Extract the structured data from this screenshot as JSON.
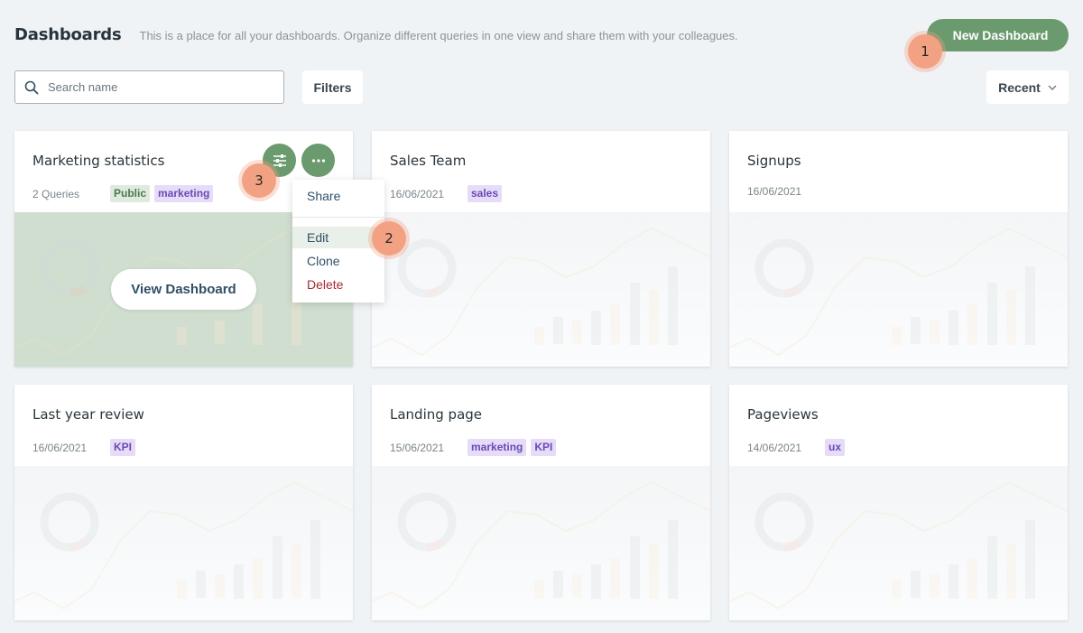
{
  "header": {
    "title": "Dashboards",
    "description": "This is a place for all your dashboards. Organize different queries in one view and share them with your colleagues.",
    "new_button": "New Dashboard"
  },
  "toolbar": {
    "search_placeholder": "Search name",
    "search_value": "",
    "filters_label": "Filters",
    "sort_label": "Recent"
  },
  "colors": {
    "accent": "#6a9a6e",
    "tag_purple_bg": "#e6dcf7",
    "tag_purple_text": "#6b49b8",
    "tag_green_bg": "#dfeadf",
    "tag_green_text": "#4b7a4e",
    "danger": "#a82a35",
    "step_badge": "#f3a183"
  },
  "cards": [
    {
      "title": "Marketing statistics",
      "meta": "2 Queries",
      "tags": [
        {
          "label": "Public",
          "style": "green"
        },
        {
          "label": "marketing",
          "style": "purple"
        }
      ],
      "hovered": true,
      "view_button": "View Dashboard"
    },
    {
      "title": "Sales Team",
      "meta": "16/06/2021",
      "tags": [
        {
          "label": "sales",
          "style": "purple"
        }
      ]
    },
    {
      "title": "Signups",
      "meta": "16/06/2021",
      "tags": []
    },
    {
      "title": "Last year review",
      "meta": "16/06/2021",
      "tags": [
        {
          "label": "KPI",
          "style": "purple"
        }
      ]
    },
    {
      "title": "Landing page",
      "meta": "15/06/2021",
      "tags": [
        {
          "label": "marketing",
          "style": "purple"
        },
        {
          "label": "KPI",
          "style": "purple"
        }
      ]
    },
    {
      "title": "Pageviews",
      "meta": "14/06/2021",
      "tags": [
        {
          "label": "ux",
          "style": "purple"
        }
      ]
    }
  ],
  "card_actions": {
    "settings_icon": "sliders-icon",
    "more_icon": "more-horizontal-icon"
  },
  "context_menu": {
    "items": [
      {
        "label": "Share"
      },
      {
        "label": "Edit",
        "active": true
      },
      {
        "label": "Clone"
      },
      {
        "label": "Delete",
        "danger": true
      }
    ]
  },
  "step_badges": [
    "1",
    "2",
    "3"
  ]
}
